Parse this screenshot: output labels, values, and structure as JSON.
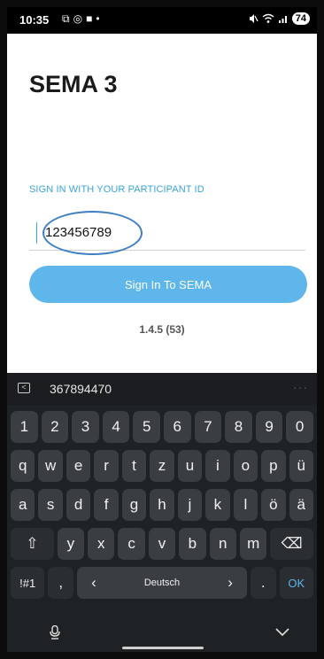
{
  "status_bar": {
    "time": "10:35",
    "left_icons": [
      "⧉",
      "◎",
      "■",
      "•"
    ],
    "battery": "74",
    "right_icons": [
      "mute-icon",
      "wifi-icon",
      "signal-icon"
    ]
  },
  "app": {
    "title": "SEMA 3",
    "signin_label": "SIGN IN WITH YOUR PARTICIPANT ID",
    "participant_id": "123456789",
    "signin_button": "Sign In To SEMA",
    "version": "1.4.5 (53)",
    "accent_color": "#5fb6ea"
  },
  "keyboard": {
    "suggestion": "367894470",
    "number_row": [
      "1",
      "2",
      "3",
      "4",
      "5",
      "6",
      "7",
      "8",
      "9",
      "0"
    ],
    "row1": [
      "q",
      "w",
      "e",
      "r",
      "t",
      "z",
      "u",
      "i",
      "o",
      "p",
      "ü"
    ],
    "row2": [
      "a",
      "s",
      "d",
      "f",
      "g",
      "h",
      "j",
      "k",
      "l",
      "ö",
      "ä"
    ],
    "row3": [
      "y",
      "x",
      "c",
      "v",
      "b",
      "n",
      "m"
    ],
    "shift": "⇧",
    "backspace": "⌫",
    "symbols": "!#1",
    "comma": ",",
    "left_arrow": "‹",
    "language": "Deutsch",
    "right_arrow": "›",
    "period": ".",
    "ok": "OK"
  }
}
